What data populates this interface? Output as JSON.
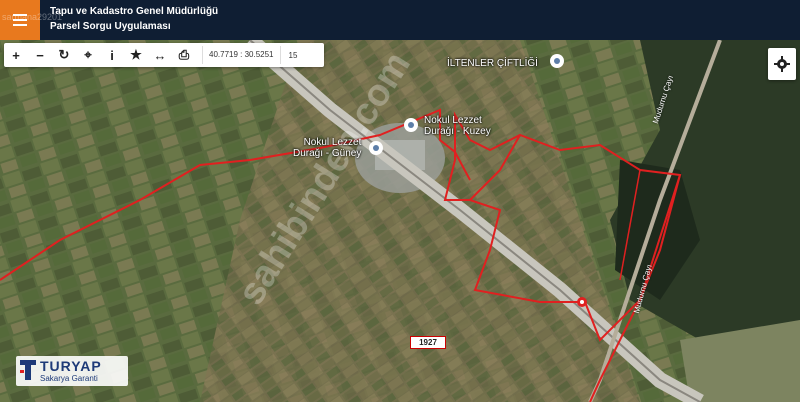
{
  "header": {
    "title_line1": "Tapu ve Kadastro Genel Müdürlüğü",
    "title_line2": "Parsel Sorgu Uygulaması",
    "menu_icon": "hamburger-icon",
    "watermark_id": "sarmana29201"
  },
  "toolbar": {
    "tools": [
      {
        "name": "zoom-in-icon",
        "glyph": "+"
      },
      {
        "name": "zoom-out-icon",
        "glyph": "−"
      },
      {
        "name": "refresh-icon",
        "glyph": "↻"
      },
      {
        "name": "locate-icon",
        "glyph": "⌖"
      },
      {
        "name": "info-icon",
        "glyph": "i"
      },
      {
        "name": "star-icon",
        "glyph": "★"
      },
      {
        "name": "measure-icon",
        "glyph": "↔"
      },
      {
        "name": "print-icon",
        "glyph": "⎙"
      }
    ],
    "coordinates": "40.7719 : 30.5251",
    "zoom_level": "15"
  },
  "map": {
    "places": [
      {
        "key": "iltenler",
        "label": "İLTENLER ÇİFTLİĞİ"
      },
      {
        "key": "kuzey",
        "label_line1": "Nokul Lezzet",
        "label_line2": "Durağı - Kuzey"
      },
      {
        "key": "guney",
        "label_line1": "Nokul Lezzet",
        "label_line2": "Durağı - Güney"
      }
    ],
    "parcel_number": "1927",
    "road_label_1": "Mudurnu Çayı",
    "road_label_2": "Mudurnu Çayı",
    "watermark": "sahibinden.com"
  },
  "logo": {
    "name": "TURYAP",
    "tagline": "Sakarya Garanti"
  },
  "colors": {
    "header_bg": "#0f1e33",
    "menu_bg": "#e8791e",
    "parcel_border": "#e02020"
  }
}
